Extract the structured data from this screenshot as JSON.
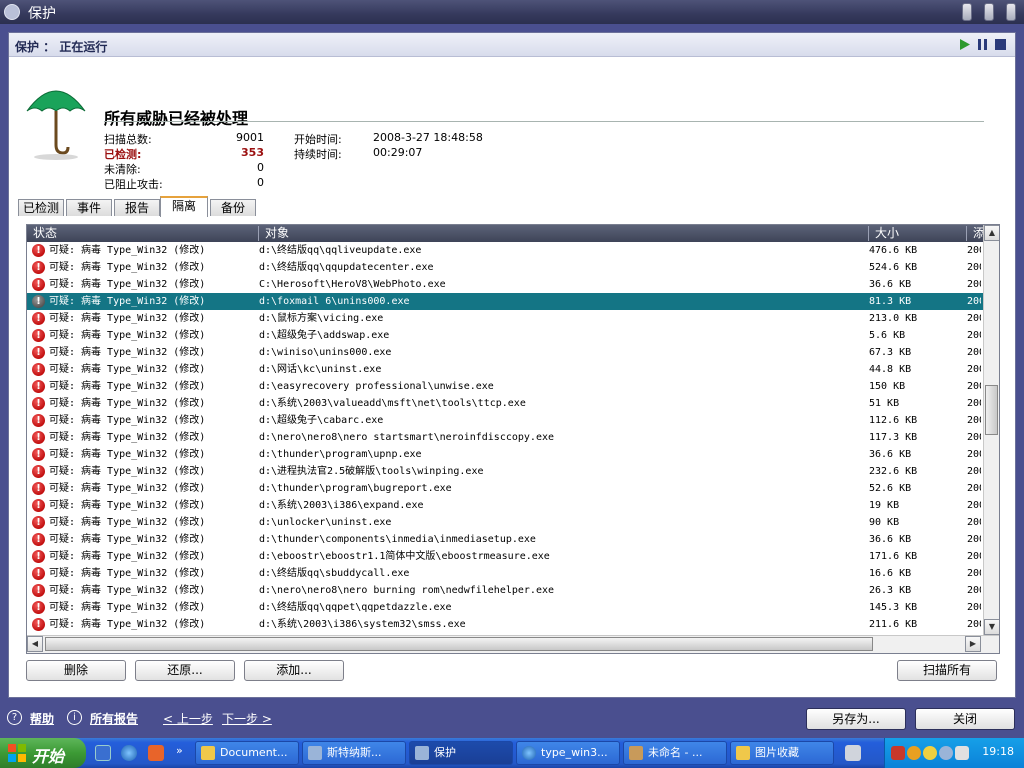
{
  "window": {
    "title": "保护"
  },
  "status": {
    "label": "保护 ： 正在运行"
  },
  "header": {
    "headline": "所有威胁已经被处理",
    "stats": [
      {
        "label": "扫描总数:",
        "value": "9001"
      },
      {
        "label": "已检测:",
        "value": "353"
      },
      {
        "label": "未清除:",
        "value": "0"
      },
      {
        "label": "已阻止攻击:",
        "value": "0"
      }
    ],
    "start_label": "开始时间:",
    "start_value": "2008-3-27 18:48:58",
    "duration_label": "持续时间:",
    "duration_value": "00:29:07"
  },
  "tabs": [
    "已检测",
    "事件",
    "报告",
    "隔离",
    "备份"
  ],
  "active_tab": "隔离",
  "columns": {
    "status": "状态",
    "object": "对象",
    "size": "大小",
    "date": "添"
  },
  "rows": [
    {
      "status": "可疑: 病毒 Type_Win32 (修改)",
      "object": "d:\\终结版qq\\qqliveupdate.exe",
      "size": "476.6 KB",
      "date": "200"
    },
    {
      "status": "可疑: 病毒 Type_Win32 (修改)",
      "object": "d:\\终结版qq\\qqupdatecenter.exe",
      "size": "524.6 KB",
      "date": "200"
    },
    {
      "status": "可疑: 病毒 Type_Win32 (修改)",
      "object": "C:\\Herosoft\\HeroV8\\WebPhoto.exe",
      "size": "36.6 KB",
      "date": "200"
    },
    {
      "status": "可疑: 病毒 Type_Win32 (修改)",
      "object": "d:\\foxmail 6\\unins000.exe",
      "size": "81.3 KB",
      "date": "200"
    },
    {
      "status": "可疑: 病毒 Type_Win32 (修改)",
      "object": "d:\\鼠标方案\\vicing.exe",
      "size": "213.0 KB",
      "date": "200"
    },
    {
      "status": "可疑: 病毒 Type_Win32 (修改)",
      "object": "d:\\超级兔子\\addswap.exe",
      "size": "5.6 KB",
      "date": "200"
    },
    {
      "status": "可疑: 病毒 Type_Win32 (修改)",
      "object": "d:\\winiso\\unins000.exe",
      "size": "67.3 KB",
      "date": "200"
    },
    {
      "status": "可疑: 病毒 Type_Win32 (修改)",
      "object": "d:\\网话\\kc\\uninst.exe",
      "size": "44.8 KB",
      "date": "200"
    },
    {
      "status": "可疑: 病毒 Type_Win32 (修改)",
      "object": "d:\\easyrecovery professional\\unwise.exe",
      "size": "150 KB",
      "date": "200"
    },
    {
      "status": "可疑: 病毒 Type_Win32 (修改)",
      "object": "d:\\系统\\2003\\valueadd\\msft\\net\\tools\\ttcp.exe",
      "size": "51 KB",
      "date": "200"
    },
    {
      "status": "可疑: 病毒 Type_Win32 (修改)",
      "object": "d:\\超级兔子\\cabarc.exe",
      "size": "112.6 KB",
      "date": "200"
    },
    {
      "status": "可疑: 病毒 Type_Win32 (修改)",
      "object": "d:\\nero\\nero8\\nero startsmart\\neroinfdisccopy.exe",
      "size": "117.3 KB",
      "date": "200"
    },
    {
      "status": "可疑: 病毒 Type_Win32 (修改)",
      "object": "d:\\thunder\\program\\upnp.exe",
      "size": "36.6 KB",
      "date": "200"
    },
    {
      "status": "可疑: 病毒 Type_Win32 (修改)",
      "object": "d:\\进程执法官2.5破解版\\tools\\winping.exe",
      "size": "232.6 KB",
      "date": "200"
    },
    {
      "status": "可疑: 病毒 Type_Win32 (修改)",
      "object": "d:\\thunder\\program\\bugreport.exe",
      "size": "52.6 KB",
      "date": "200"
    },
    {
      "status": "可疑: 病毒 Type_Win32 (修改)",
      "object": "d:\\系统\\2003\\i386\\expand.exe",
      "size": "19 KB",
      "date": "200"
    },
    {
      "status": "可疑: 病毒 Type_Win32 (修改)",
      "object": "d:\\unlocker\\uninst.exe",
      "size": "90 KB",
      "date": "200"
    },
    {
      "status": "可疑: 病毒 Type_Win32 (修改)",
      "object": "d:\\thunder\\components\\inmedia\\inmediasetup.exe",
      "size": "36.6 KB",
      "date": "200"
    },
    {
      "status": "可疑: 病毒 Type_Win32 (修改)",
      "object": "d:\\eboostr\\eboostr1.1简体中文版\\eboostrmeasure.exe",
      "size": "171.6 KB",
      "date": "200"
    },
    {
      "status": "可疑: 病毒 Type_Win32 (修改)",
      "object": "d:\\终结版qq\\sbuddycall.exe",
      "size": "16.6 KB",
      "date": "200"
    },
    {
      "status": "可疑: 病毒 Type_Win32 (修改)",
      "object": "d:\\nero\\nero8\\nero burning rom\\nedwfilehelper.exe",
      "size": "26.3 KB",
      "date": "200"
    },
    {
      "status": "可疑: 病毒 Type_Win32 (修改)",
      "object": "d:\\终结版qq\\qqpet\\qqpetdazzle.exe",
      "size": "145.3 KB",
      "date": "200"
    },
    {
      "status": "可疑: 病毒 Type_Win32 (修改)",
      "object": "d:\\系统\\2003\\i386\\system32\\smss.exe",
      "size": "211.6 KB",
      "date": "200"
    }
  ],
  "selected_row": 3,
  "buttons": {
    "delete": "删除",
    "restore": "还原...",
    "add": "添加...",
    "scan_all": "扫描所有"
  },
  "footer": {
    "help": "帮助",
    "all_reports": "所有报告",
    "prev": "< 上一步",
    "next": "下一步 >",
    "save_as": "另存为...",
    "close": "关闭"
  },
  "taskbar": {
    "start": "开始",
    "items": [
      "Document...",
      "斯特纳斯...",
      "保护",
      "type_win3...",
      "未命名 - ...",
      "图片收藏"
    ],
    "active": "保护",
    "clock": "19:18"
  },
  "colors": {
    "selection": "#147585",
    "accent": "#4a4f8f",
    "danger": "#c10f0f",
    "detected": "#9b1010"
  }
}
